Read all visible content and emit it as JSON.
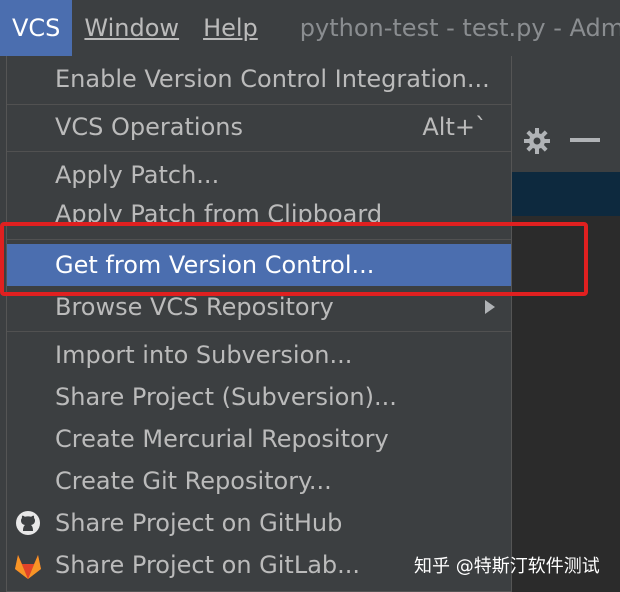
{
  "menubar": {
    "vcs": "VCS",
    "window": "Window",
    "help": "Help",
    "title": "python-test - test.py - Adm"
  },
  "menu": {
    "enable_vci": "Enable Version Control Integration...",
    "vcs_operations": "VCS Operations",
    "vcs_operations_shortcut": "Alt+`",
    "apply_patch": "Apply Patch...",
    "apply_patch_clipboard": "Apply Patch from Clipboard",
    "get_from_vc": "Get from Version Control...",
    "browse_vcs": "Browse VCS Repository",
    "import_svn": "Import into Subversion...",
    "share_svn": "Share Project (Subversion)...",
    "create_hg": "Create Mercurial Repository",
    "create_git": "Create Git Repository...",
    "share_github": "Share Project on GitHub",
    "share_gitlab": "Share Project on GitLab..."
  },
  "icons": {
    "gear": "gear-icon",
    "minimize": "minus-icon",
    "github": "github-icon",
    "gitlab": "gitlab-icon",
    "submenu": "chevron-right-icon"
  },
  "colors": {
    "selection": "#4b6eaf",
    "highlight": "#e02020",
    "menu_bg": "#3c3f41"
  },
  "watermark": "知乎 @特斯汀软件测试"
}
